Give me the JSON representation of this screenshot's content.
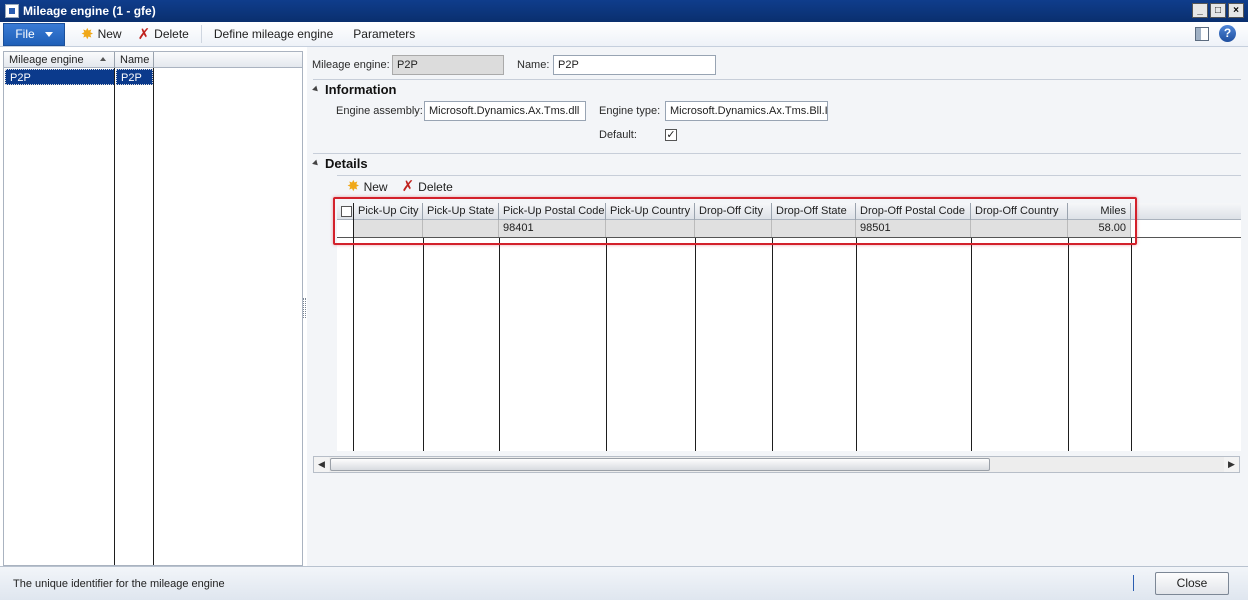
{
  "window": {
    "title": "Mileage engine (1 - gfe)",
    "controls": [
      "_",
      "□",
      "×"
    ]
  },
  "toolbar": {
    "file_label": "File",
    "new_label": "New",
    "delete_label": "Delete",
    "define_label": "Define mileage engine",
    "parameters_label": "Parameters",
    "help_label": "?"
  },
  "list": {
    "columns": [
      "Mileage engine",
      "Name"
    ],
    "rows": [
      {
        "engine": "P2P",
        "name": "P2P"
      }
    ]
  },
  "form": {
    "engine_label": "Mileage engine:",
    "engine_value": "P2P",
    "name_label": "Name:",
    "name_value": "P2P",
    "information": {
      "title": "Information",
      "assembly_label": "Engine assembly:",
      "assembly_value": "Microsoft.Dynamics.Ax.Tms.dll",
      "type_label": "Engine type:",
      "type_value": "Microsoft.Dynamics.Ax.Tms.Bll.I",
      "default_label": "Default:",
      "default_checked": true,
      "check_mark": "✓"
    },
    "details": {
      "title": "Details",
      "new_label": "New",
      "delete_label": "Delete",
      "columns": [
        "Pick-Up City",
        "Pick-Up State",
        "Pick-Up Postal Code",
        "Pick-Up Country",
        "Drop-Off City",
        "Drop-Off State",
        "Drop-Off Postal Code",
        "Drop-Off Country",
        "Miles"
      ],
      "rows": [
        [
          "",
          "",
          "98401",
          "",
          "",
          "",
          "98501",
          "",
          "58.00"
        ]
      ]
    }
  },
  "status": {
    "message": "The unique identifier for the mileage engine",
    "close_label": "Close"
  },
  "colors": {
    "titlebar": "#0f3d8c",
    "selection": "#0b3a8c",
    "highlight_box": "#d3212b",
    "new_icon": "#f0a818",
    "delete_icon": "#c0221e"
  }
}
